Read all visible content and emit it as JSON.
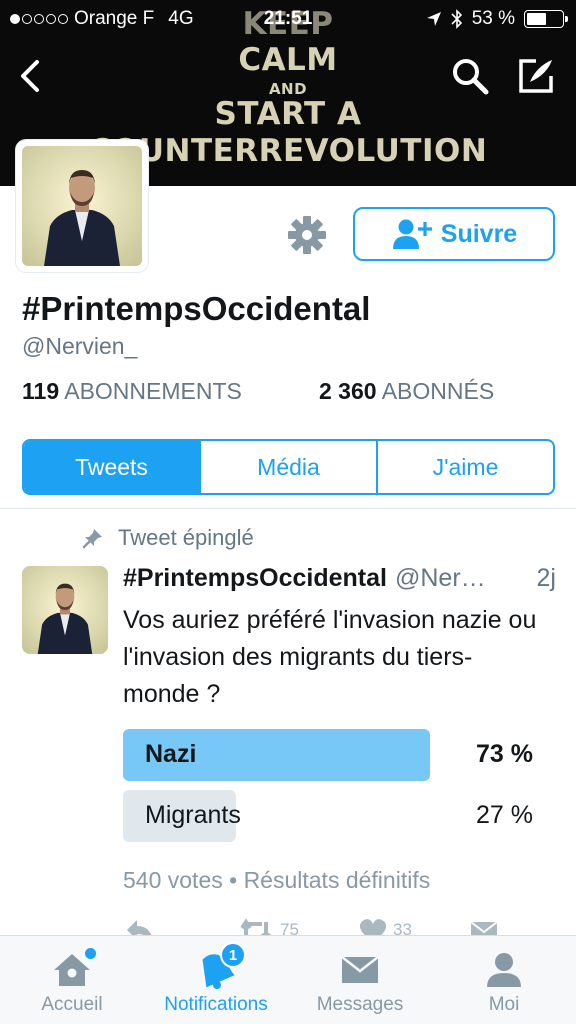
{
  "status_bar": {
    "carrier": "Orange F",
    "network": "4G",
    "time": "21:51",
    "battery": "53 %"
  },
  "banner": {
    "line1": "KEEP",
    "line2": "CALM",
    "line3": "AND",
    "line4": "START A",
    "line5": "COUNTERREVOLUTION"
  },
  "profile": {
    "display_name": "#PrintempsOccidental",
    "handle": "@Nervien_",
    "follow_label": "Suivre",
    "following_count": "119",
    "following_label": "ABONNEMENTS",
    "followers_count": "2 360",
    "followers_label": "ABONNÉS"
  },
  "tabs": [
    {
      "label": "Tweets",
      "active": true
    },
    {
      "label": "Média",
      "active": false
    },
    {
      "label": "J'aime",
      "active": false
    }
  ],
  "tweet": {
    "pinned_label": "Tweet épinglé",
    "name": "#PrintempsOccidental",
    "handle": "@Nervien_",
    "time": "2j",
    "text": "Vos auriez préféré l'invasion nazie ou l'invasion des migrants du tiers-monde ?",
    "poll": {
      "options": [
        {
          "label": "Nazi",
          "percent_text": "73 %",
          "percent": 73,
          "winner": true
        },
        {
          "label": "Migrants",
          "percent_text": "27 %",
          "percent": 27,
          "winner": false
        }
      ],
      "meta": "540 votes • Résultats définitifs"
    },
    "actions": {
      "retweets": "75",
      "likes": "33"
    }
  },
  "tabbar": {
    "home": "Accueil",
    "notifications": "Notifications",
    "notifications_badge": "1",
    "messages": "Messages",
    "me": "Moi"
  },
  "colors": {
    "accent": "#1da1f2",
    "poll_winner": "#77c7f7",
    "poll_other": "#e1e8ed",
    "muted": "#657786"
  }
}
